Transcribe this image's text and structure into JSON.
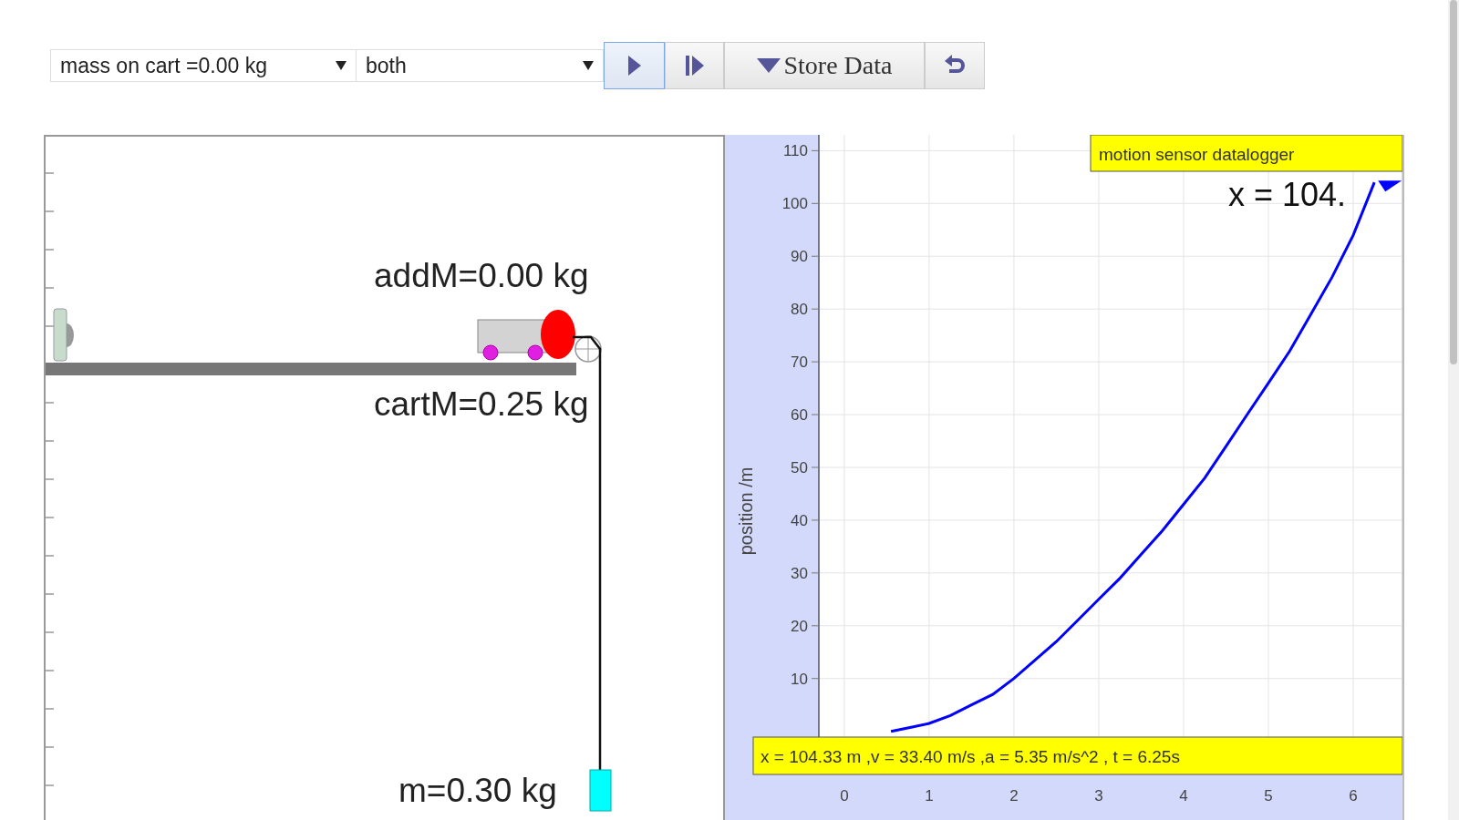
{
  "toolbar": {
    "selects": [
      {
        "value": "mass on cart =0.00 kg"
      },
      {
        "value": "both"
      }
    ],
    "buttons": [
      {
        "kind": "play",
        "focused": true
      },
      {
        "kind": "step",
        "focused": false
      },
      {
        "kind": "store",
        "label": "Store Data",
        "focused": false
      },
      {
        "kind": "reset",
        "focused": false
      }
    ]
  },
  "simulation": {
    "added_mass": "addM=0.00 kg",
    "cart_mass": "cartM=0.25 kg",
    "hanging_mass": "m=0.30 kg"
  },
  "graph": {
    "tag": "motion sensor datalogger",
    "reading": "x = 104.",
    "readout": "x = 104.33 m ,v = 33.40 m/s ,a = 5.35 m/s^2 , t = 6.25s",
    "chart_data": {
      "type": "line",
      "ylabel": "position /m",
      "x": [
        0.55,
        0.8,
        1,
        1.25,
        1.5,
        1.75,
        2,
        2.25,
        2.5,
        2.75,
        3,
        3.25,
        3.5,
        3.75,
        4,
        4.25,
        4.5,
        4.75,
        5,
        5.25,
        5.5,
        5.75,
        6,
        6.25
      ],
      "series": [
        {
          "color": "#0000ff",
          "values": [
            0,
            0.8,
            1.5,
            3,
            5,
            7,
            10,
            13.5,
            17,
            21,
            25,
            29,
            33.5,
            38,
            43,
            48,
            54,
            60,
            66,
            72,
            79,
            86,
            94,
            104
          ]
        }
      ],
      "xlim": [
        -0.3,
        6.57
      ],
      "ylim": [
        -8,
        113
      ],
      "grid": true,
      "xticks": [
        0,
        1,
        2,
        3,
        4,
        5,
        6
      ],
      "yticks": [
        10,
        20,
        30,
        40,
        50,
        60,
        70,
        80,
        90,
        100,
        110
      ]
    }
  }
}
